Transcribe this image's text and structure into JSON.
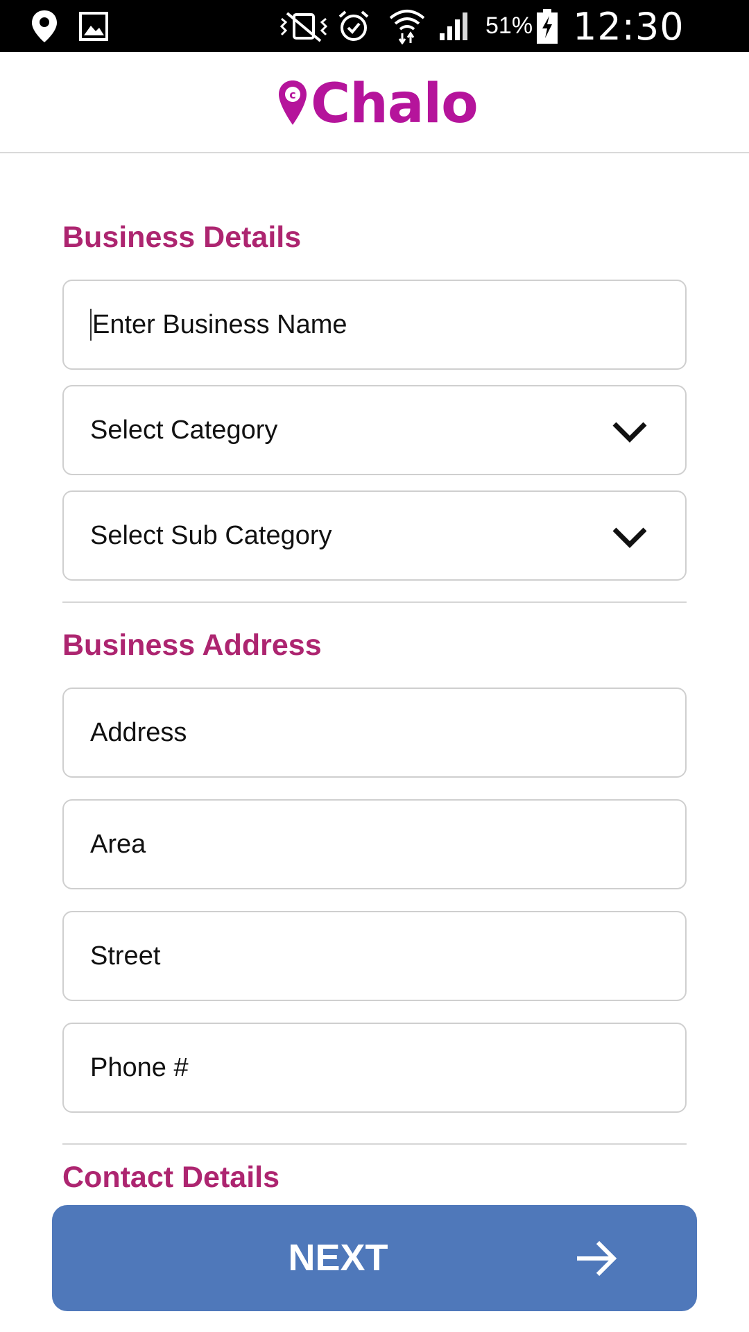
{
  "status_bar": {
    "icons": [
      "location-icon",
      "image-icon",
      "vibrate-icon",
      "alarm-icon",
      "wifi-icon",
      "signal-icon",
      "battery-charging-icon"
    ],
    "battery_percent": "51%",
    "time": "12:30 pm"
  },
  "header": {
    "logo_text": "Chalo",
    "logo_icon": "map-pin-icon",
    "brand_color": "#b5149b"
  },
  "form": {
    "business_details": {
      "title": "Business Details",
      "business_name_placeholder": "Enter Business Name",
      "category_placeholder": "Select Category",
      "subcategory_placeholder": "Select Sub Category"
    },
    "business_address": {
      "title": "Business Address",
      "address_placeholder": "Address",
      "area_placeholder": "Area",
      "street_placeholder": "Street",
      "phone_placeholder": "Phone #"
    },
    "contact_details": {
      "title": "Contact Details"
    },
    "section_title_color": "#ad2570"
  },
  "next_button": {
    "label": "NEXT",
    "icon": "arrow-right-icon",
    "color": "#4f78ba"
  }
}
